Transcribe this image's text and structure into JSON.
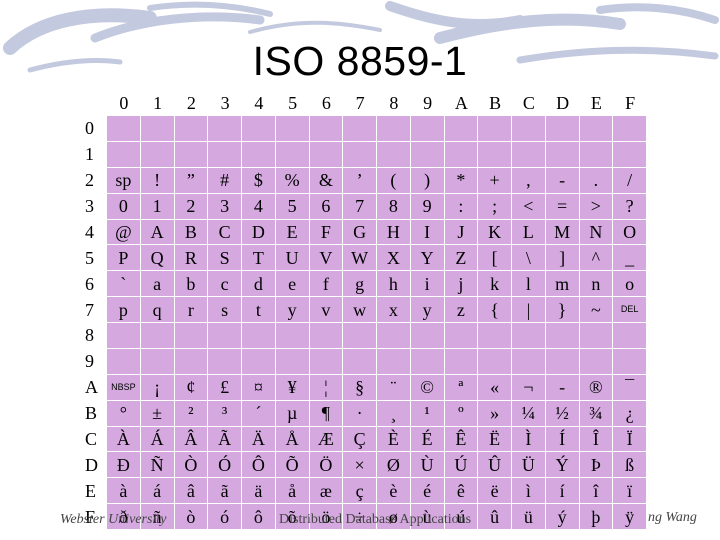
{
  "title": "ISO 8859-1",
  "columns": [
    "0",
    "1",
    "2",
    "3",
    "4",
    "5",
    "6",
    "7",
    "8",
    "9",
    "A",
    "B",
    "C",
    "D",
    "E",
    "F"
  ],
  "rows": [
    {
      "label": "0",
      "cells": [
        "",
        "",
        "",
        "",
        "",
        "",
        "",
        "",
        "",
        "",
        "",
        "",
        "",
        "",
        "",
        ""
      ]
    },
    {
      "label": "1",
      "cells": [
        "",
        "",
        "",
        "",
        "",
        "",
        "",
        "",
        "",
        "",
        "",
        "",
        "",
        "",
        "",
        ""
      ]
    },
    {
      "label": "2",
      "cells": [
        "sp",
        "!",
        "”",
        "#",
        "$",
        "%",
        "&",
        "’",
        "(",
        ")",
        "*",
        "+",
        ",",
        "-",
        ".",
        "/"
      ]
    },
    {
      "label": "3",
      "cells": [
        "0",
        "1",
        "2",
        "3",
        "4",
        "5",
        "6",
        "7",
        "8",
        "9",
        ":",
        ";",
        "<",
        "=",
        ">",
        "?"
      ]
    },
    {
      "label": "4",
      "cells": [
        "@",
        "A",
        "B",
        "C",
        "D",
        "E",
        "F",
        "G",
        "H",
        "I",
        "J",
        "K",
        "L",
        "M",
        "N",
        "O"
      ]
    },
    {
      "label": "5",
      "cells": [
        "P",
        "Q",
        "R",
        "S",
        "T",
        "U",
        "V",
        "W",
        "X",
        "Y",
        "Z",
        "[",
        "\\",
        "]",
        "^",
        "_"
      ]
    },
    {
      "label": "6",
      "cells": [
        "`",
        "a",
        "b",
        "c",
        "d",
        "e",
        "f",
        "g",
        "h",
        "i",
        "j",
        "k",
        "l",
        "m",
        "n",
        "o"
      ]
    },
    {
      "label": "7",
      "cells": [
        "p",
        "q",
        "r",
        "s",
        "t",
        "y",
        "v",
        "w",
        "x",
        "y",
        "z",
        "{",
        "|",
        "}",
        "~",
        "DEL"
      ]
    },
    {
      "label": "8",
      "cells": [
        "",
        "",
        "",
        "",
        "",
        "",
        "",
        "",
        "",
        "",
        "",
        "",
        "",
        "",
        "",
        ""
      ]
    },
    {
      "label": "9",
      "cells": [
        "",
        "",
        "",
        "",
        "",
        "",
        "",
        "",
        "",
        "",
        "",
        "",
        "",
        "",
        "",
        ""
      ]
    },
    {
      "label": "A",
      "cells": [
        "NBSP",
        "¡",
        "¢",
        "£",
        "¤",
        "¥",
        "¦",
        "§",
        "¨",
        "©",
        "ª",
        "«",
        "¬",
        "-",
        "®",
        "¯"
      ]
    },
    {
      "label": "B",
      "cells": [
        "°",
        "±",
        "²",
        "³",
        "´",
        "µ",
        "¶",
        "·",
        "¸",
        "¹",
        "º",
        "»",
        "¼",
        "½",
        "¾",
        "¿"
      ]
    },
    {
      "label": "C",
      "cells": [
        "À",
        "Á",
        "Â",
        "Ã",
        "Ä",
        "Å",
        "Æ",
        "Ç",
        "È",
        "É",
        "Ê",
        "Ë",
        "Ì",
        "Í",
        "Î",
        "Ï"
      ]
    },
    {
      "label": "D",
      "cells": [
        "Ð",
        "Ñ",
        "Ò",
        "Ó",
        "Ô",
        "Õ",
        "Ö",
        "×",
        "Ø",
        "Ù",
        "Ú",
        "Û",
        "Ü",
        "Ý",
        "Þ",
        "ß"
      ]
    },
    {
      "label": "E",
      "cells": [
        "à",
        "á",
        "â",
        "ã",
        "ä",
        "å",
        "æ",
        "ç",
        "è",
        "é",
        "ê",
        "ë",
        "ì",
        "í",
        "î",
        "ï"
      ]
    },
    {
      "label": "F",
      "cells": [
        "ð",
        "ñ",
        "ò",
        "ó",
        "ô",
        "õ",
        "ö",
        "÷",
        "ø",
        "ù",
        "ú",
        "û",
        "ü",
        "ý",
        "þ",
        "ÿ"
      ]
    }
  ],
  "footer": {
    "left": "Webster University",
    "center": "Distributed Database Applications",
    "right": "ng Wang"
  },
  "colors": {
    "cell_bg": "#d5a9df",
    "swoosh": "#b8c0d8"
  }
}
